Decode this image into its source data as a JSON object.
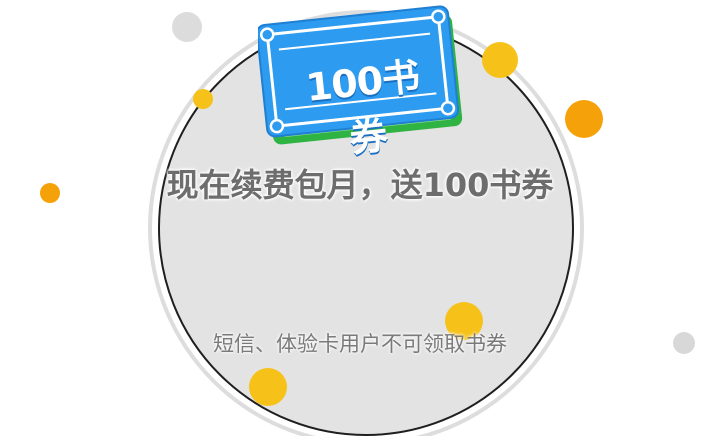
{
  "ticket": {
    "value_label": "100书券"
  },
  "promo": {
    "headline": "现在续费包月，送100书券",
    "note": "短信、体验卡用户不可领取书券"
  },
  "colors": {
    "ticket_blue": "#2d9bef",
    "ticket_green": "#2fb343",
    "accent_yellow": "#f6c21a",
    "accent_orange": "#f5a20a",
    "circle_gray": "#e3e3e3"
  }
}
